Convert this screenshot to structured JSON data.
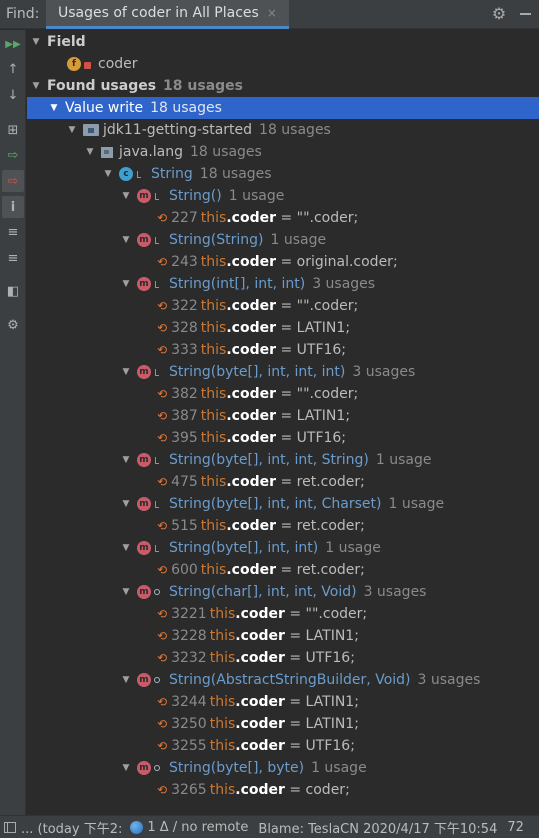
{
  "header": {
    "find_label": "Find:",
    "tab_title": "Usages of coder in All Places",
    "tab_close": "×"
  },
  "toolbar": {
    "buttons": [
      {
        "name": "rerun",
        "glyph": "▶▶"
      },
      {
        "name": "prev-occurrence",
        "glyph": "↑"
      },
      {
        "name": "next-occurrence",
        "glyph": "↓"
      },
      {
        "name": "group",
        "glyph": "⊞"
      },
      {
        "name": "show-read",
        "glyph": "⇨"
      },
      {
        "name": "show-write",
        "glyph": "⇨"
      },
      {
        "name": "show-info",
        "glyph": "i"
      },
      {
        "name": "expand-all",
        "glyph": "≡"
      },
      {
        "name": "collapse-all",
        "glyph": "≡"
      },
      {
        "name": "preview",
        "glyph": "◧"
      },
      {
        "name": "settings",
        "glyph": "⚙"
      }
    ]
  },
  "tree": {
    "field_header": "Field",
    "field_name": "coder",
    "found_usages": "Found usages",
    "found_count": "18 usages",
    "value_write": "Value write",
    "value_write_count": "18 usages",
    "project": "jdk11-getting-started",
    "project_count": "18 usages",
    "package": "java.lang",
    "package_count": "18 usages",
    "class": "String",
    "class_count": "18 usages",
    "this_kw": "this",
    "field_ref": ".coder",
    "eq": " = ",
    "methods": [
      {
        "sig": "String()",
        "count": "1 usage",
        "vis": "public",
        "lines": [
          {
            "n": "227",
            "v": "\"\".coder;"
          }
        ]
      },
      {
        "sig": "String(String)",
        "count": "1 usage",
        "vis": "public",
        "lines": [
          {
            "n": "243",
            "v": "original.coder;"
          }
        ]
      },
      {
        "sig": "String(int[], int, int)",
        "count": "3 usages",
        "vis": "public",
        "lines": [
          {
            "n": "322",
            "v": "\"\".coder;"
          },
          {
            "n": "328",
            "v": "LATIN1;"
          },
          {
            "n": "333",
            "v": "UTF16;"
          }
        ]
      },
      {
        "sig": "String(byte[], int, int, int)",
        "count": "3 usages",
        "vis": "public",
        "lines": [
          {
            "n": "382",
            "v": "\"\".coder;"
          },
          {
            "n": "387",
            "v": "LATIN1;"
          },
          {
            "n": "395",
            "v": "UTF16;"
          }
        ]
      },
      {
        "sig": "String(byte[], int, int, String)",
        "count": "1 usage",
        "vis": "public",
        "lines": [
          {
            "n": "475",
            "v": "ret.coder;"
          }
        ]
      },
      {
        "sig": "String(byte[], int, int, Charset)",
        "count": "1 usage",
        "vis": "public",
        "lines": [
          {
            "n": "515",
            "v": "ret.coder;"
          }
        ]
      },
      {
        "sig": "String(byte[], int, int)",
        "count": "1 usage",
        "vis": "public",
        "lines": [
          {
            "n": "600",
            "v": "ret.coder;"
          }
        ]
      },
      {
        "sig": "String(char[], int, int, Void)",
        "count": "3 usages",
        "vis": "package",
        "lines": [
          {
            "n": "3221",
            "v": "\"\".coder;"
          },
          {
            "n": "3228",
            "v": "LATIN1;"
          },
          {
            "n": "3232",
            "v": "UTF16;"
          }
        ]
      },
      {
        "sig": "String(AbstractStringBuilder, Void)",
        "count": "3 usages",
        "vis": "package",
        "lines": [
          {
            "n": "3244",
            "v": "LATIN1;"
          },
          {
            "n": "3250",
            "v": "LATIN1;"
          },
          {
            "n": "3255",
            "v": "UTF16;"
          }
        ]
      },
      {
        "sig": "String(byte[], byte)",
        "count": "1 usage",
        "vis": "package",
        "lines": [
          {
            "n": "3265",
            "v": "coder;"
          }
        ]
      }
    ]
  },
  "status": {
    "left": "... (today 下午2:",
    "vcs": "1 Δ / no remote",
    "blame": "Blame: TeslaCN 2020/4/17 下午10:54",
    "trailing": "72"
  },
  "colors": {
    "selection": "#2f65ca",
    "keyword": "#cc7832",
    "signature": "#6b9ccc",
    "method_icon": "#c75c68",
    "field_icon": "#d69b3a",
    "class_icon": "#3f9fcf"
  }
}
